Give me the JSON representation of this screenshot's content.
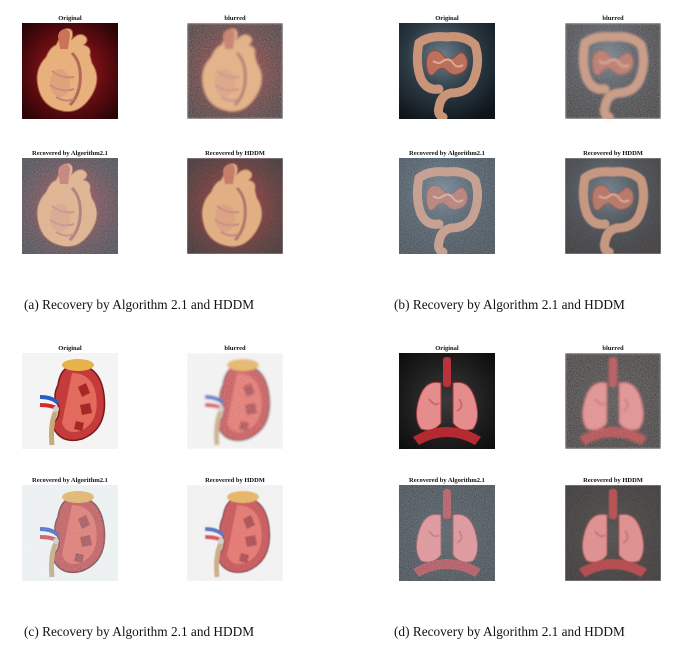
{
  "figure": {
    "panels": [
      {
        "id": "a",
        "caption": "(a) Recovery by Algorithm 2.1 and HDDM",
        "subject": "heart",
        "images": [
          {
            "title": "Original",
            "variant": "clean"
          },
          {
            "title": "blurred",
            "variant": "blurred"
          },
          {
            "title": "Recovered by Algorithm2.1",
            "variant": "recovered-alg"
          },
          {
            "title": "Recovered by HDDM",
            "variant": "recovered-hddm"
          }
        ]
      },
      {
        "id": "b",
        "caption": "(b) Recovery by Algorithm 2.1 and HDDM",
        "subject": "intestine",
        "images": [
          {
            "title": "Original",
            "variant": "clean"
          },
          {
            "title": "blurred",
            "variant": "blurred"
          },
          {
            "title": "Recovered by Algorithm2.1",
            "variant": "recovered-alg"
          },
          {
            "title": "Recovered by HDDM",
            "variant": "recovered-hddm"
          }
        ]
      },
      {
        "id": "c",
        "caption": "(c) Recovery by Algorithm 2.1 and HDDM",
        "subject": "kidney",
        "images": [
          {
            "title": "Original",
            "variant": "clean"
          },
          {
            "title": "blurred",
            "variant": "blurred"
          },
          {
            "title": "Recovered by Algorithm2.1",
            "variant": "recovered-alg"
          },
          {
            "title": "Recovered by HDDM",
            "variant": "recovered-hddm"
          }
        ]
      },
      {
        "id": "d",
        "caption": "(d) Recovery by Algorithm 2.1 and HDDM",
        "subject": "lungs",
        "images": [
          {
            "title": "Original",
            "variant": "clean"
          },
          {
            "title": "blurred",
            "variant": "blurred"
          },
          {
            "title": "Recovered by Algorithm2.1",
            "variant": "recovered-alg"
          },
          {
            "title": "Recovered by HDDM",
            "variant": "recovered-hddm"
          }
        ]
      }
    ]
  },
  "colors": {
    "heart_bg": "#5a0a0c",
    "intestine_bg": "#1a2530",
    "kidney_bg": "#f4f4f4",
    "lungs_bg": "#0b0b0b",
    "caption_text": "#111111"
  }
}
